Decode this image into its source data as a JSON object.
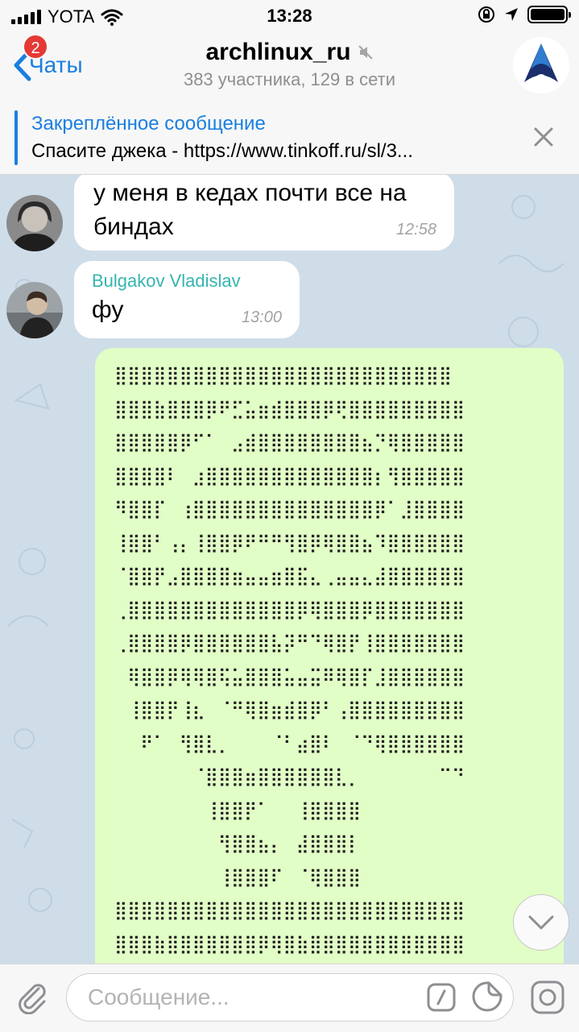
{
  "status_bar": {
    "carrier": "YOTA",
    "time": "13:28",
    "icons": [
      "signal-icon",
      "wifi-icon",
      "orientation-lock-icon",
      "location-icon",
      "battery-icon"
    ]
  },
  "nav": {
    "back_label": "Чаты",
    "unread_badge": "2",
    "title": "archlinux_ru",
    "subtitle": "383 участника, 129 в сети",
    "muted_icon": "mute-icon",
    "avatar_icon": "archlinux-logo-icon"
  },
  "pinned": {
    "title": "Закреплённое сообщение",
    "text": "Спасите джека - https://www.tinkoff.ru/sl/3..."
  },
  "messages": [
    {
      "text_line1": "у меня в кедах почти все на",
      "text_line2": "биндах",
      "time": "12:58"
    },
    {
      "sender": "Bulgakov Vladislav",
      "text": "фу",
      "time": "13:00"
    },
    {
      "braille_art": [
        "⣿⣿⣿⣿⣿⣿⣿⣿⣿⣿⣿⣿⣿⣿⣿⣿⣿⣿⣿⣿⣿⣿⣿⣿⣿⣿",
        "⣿⣿⣿⣷⣿⣿⣿⡿⠟⣋⣥⣶⣾⣿⣿⣿⡿⢟⣿⣿⣿⣿⣿⣿⣿⣿⣿",
        "⣿⣿⣿⣿⣿⡿⠋⠁⠀⣠⣾⣿⣿⣿⣿⣿⣿⣿⣿⣦⡙⢿⣿⣿⣿⣿⣿",
        "⣿⣿⣿⣿⠇⠀⣰⣿⣿⣿⣿⣿⣿⣿⣿⣿⣿⣿⣿⣿⡆⢻⣿⣿⣿⣿⣿",
        "⠻⣿⣿⡏⠀⢰⣿⣿⣿⣿⣿⣿⣿⣿⣿⣿⣿⣿⣿⣿⡿⠁⣸⣿⣿⣿⣿",
        "⢸⣿⣿⠃⢠⡄⢸⣿⣿⡿⠟⠛⠛⢻⣿⡿⢿⣿⣿⣦⠹⣿⣿⣿⣿⣿⣿",
        "⠈⣿⣿⡟⣠⣿⣿⣿⣿⣶⣤⣤⣶⣿⣯⣄⢀⣤⣤⣄⣼⣿⣿⣿⣿⣿⣿",
        "⢀⣿⣿⣿⣿⣿⣿⣿⣿⣿⣿⣿⣿⣿⡿⢿⣿⣿⣿⡿⣿⣿⣿⣿⣿⣿⣿",
        "⢀⣿⣿⣿⣿⡿⣿⣿⣿⣿⣿⣿⣧⡽⠛⠙⢿⣿⡟⢸⣿⣿⣿⣿⣿⣿⣿",
        "⠀⢿⣿⣿⡿⢿⢿⣿⢯⣥⣿⣿⣿⣥⣤⣭⠿⢿⣿⡏⣸⣿⣿⣿⣿⣿⣿",
        "⠀⢸⣿⣿⡟⢸⣆⠀⠈⠛⢿⣿⣶⣾⣿⡿⠃⢠⣿⣿⣿⣿⣿⣿⣿⣿⣿",
        "⠀⠀⠟⠁⠀⢻⣿⣇⡀⠀⠀⠀⠈⠃⣴⣿⠇⠀⠈⠙⢿⣿⣿⣿⣿⣿⣿",
        "⠀⠀⠀⠀⠀⠀⠈⣿⣿⣿⣶⣿⣿⣿⣿⣿⣿⣇⡀⠀⠀⠀⠀⠀⠀⠉⠙",
        "⠀⠀⠀⠀⠀⠀⠀⢸⣿⣿⡟⠁⠀⠀⢸⣿⣿⣿⣿⠀⠀⠀⠀⠀⠀⠀⠀",
        "⠀⠀⠀⠀⠀⠀⠀⠀⢻⣿⣿⣦⡄⠀⣼⣿⣿⣿⡇⠀⠀⠀⠀⠀⠀⠀⠀",
        "⠀⠀⠀⠀⠀⠀⠀⠀⢸⣿⣿⣿⠏⠀⠈⢿⣿⣿⣿⠀⠀⠀⠀⠀⠀⠀⠀",
        "⣿⣿⣿⣿⣿⣿⣿⣿⣿⣿⣿⣿⣿⣿⣿⣿⣿⣿⣿⣿⣿⣿⣿⣿⣿⣿⣿",
        "⣿⣿⣿⣷⣿⣿⣿⣿⣿⣿⣿⡿⢿⣿⣷⣿⣿⣿⣿⣿⣿⣿⣿⣿⣿⣿⣿"
      ]
    }
  ],
  "composer": {
    "placeholder": "Сообщение..."
  },
  "colors": {
    "accent": "#1a7fe0",
    "sender_name": "#35b5b0",
    "outgoing_bubble": "#e1fec6",
    "badge": "#e53935",
    "chat_background": "#cfdde9"
  }
}
